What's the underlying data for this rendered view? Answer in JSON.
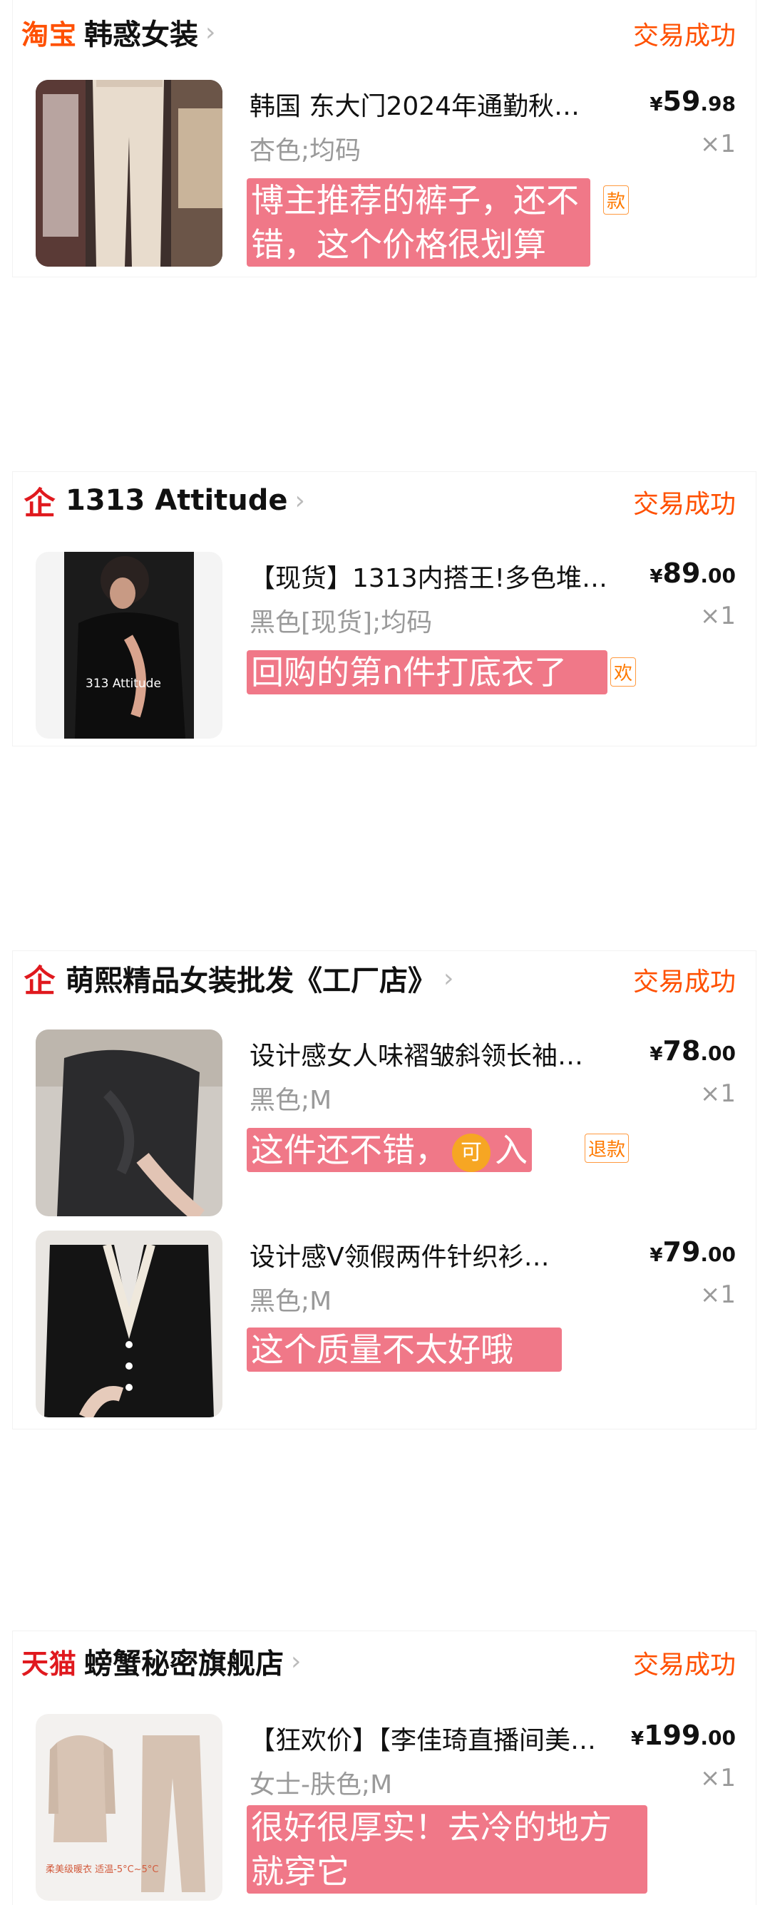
{
  "orders": [
    {
      "logo": "淘宝",
      "store": "韩惑女装",
      "status": "交易成功",
      "items": [
        {
          "title": "韩国 东大门2024年通勤秋…",
          "price_int": "59",
          "price_dec": ".98",
          "currency": "¥",
          "spec": "杏色;均码",
          "qty": "×1",
          "note_line1": "博主推荐的裤子，还不",
          "note_line2": "错，这个价格很划算",
          "tag": "款"
        }
      ]
    },
    {
      "logo": "企",
      "store": "1313 Attitude",
      "status": "交易成功",
      "items": [
        {
          "title": "【现货】1313内搭王!多色堆…",
          "price_int": "89",
          "price_dec": ".00",
          "currency": "¥",
          "spec": "黑色[现货];均码",
          "qty": "×1",
          "note_line1": "回购的第n件打底衣了",
          "tag": "欢",
          "thumb_text": "313 Attitude"
        }
      ]
    },
    {
      "logo": "企",
      "store": "萌熙精品女装批发《工厂店》",
      "status": "交易成功",
      "items": [
        {
          "title": "设计感女人味褶皱斜领长袖…",
          "price_int": "78",
          "price_dec": ".00",
          "currency": "¥",
          "spec": "黑色;M",
          "qty": "×1",
          "note_pre": "这件还不错，",
          "note_face": "可",
          "note_post": "入",
          "tag": "退款"
        },
        {
          "title": "设计感V领假两件针织衫…",
          "price_int": "79",
          "price_dec": ".00",
          "currency": "¥",
          "spec": "黑色;M",
          "qty": "×1",
          "note_line1": "这个质量不太好哦"
        }
      ]
    },
    {
      "logo": "天猫",
      "store": "螃蟹秘密旗舰店",
      "status": "交易成功",
      "items": [
        {
          "title": "【狂欢价】【李佳琦直播间美…",
          "price_int": "199",
          "price_dec": ".00",
          "currency": "¥",
          "spec": "女士-肤色;M",
          "qty": "×1",
          "note_line1": "很好很厚实！去冷的地方",
          "note_line2": "就穿它",
          "thumb_text": "柔美级暖衣 适温-5°C~5°C"
        }
      ]
    }
  ],
  "colors": {
    "accent": "#ff5000",
    "note_bg": "#f07888",
    "tmall": "#e0191e"
  },
  "icons": [
    "chevron-right-icon",
    "qi-store-icon",
    "smile-face-icon"
  ]
}
